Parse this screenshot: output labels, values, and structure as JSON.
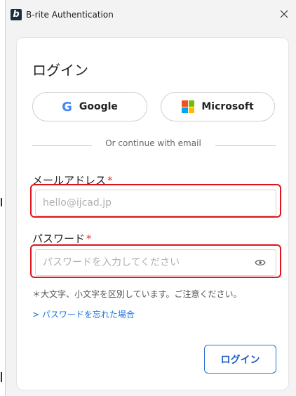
{
  "window": {
    "title": "B-rite Authentication",
    "app_icon_letter": "b",
    "close_icon": "close-icon"
  },
  "login": {
    "heading": "ログイン",
    "sso": {
      "google_label": "Google",
      "microsoft_label": "Microsoft"
    },
    "divider_text": "Or continue with email",
    "email": {
      "label": "メールアドレス",
      "required_mark": "*",
      "placeholder": "hello@ijcad.jp",
      "value": ""
    },
    "password": {
      "label": "パスワード",
      "required_mark": "*",
      "placeholder": "パスワードを入力してください",
      "value": "",
      "toggle_icon": "eye-icon"
    },
    "note": "＊大文字、小文字を区別しています。ご注意ください。",
    "forgot_link": "> パスワードを忘れた場合",
    "submit_label": "ログイン"
  },
  "colors": {
    "highlight": "#e0141c",
    "link": "#1a73e8",
    "primary_border": "#2a6fcf",
    "required": "#e53935",
    "microsoft": [
      "#f25022",
      "#7fba00",
      "#00a4ef",
      "#ffb900"
    ]
  }
}
